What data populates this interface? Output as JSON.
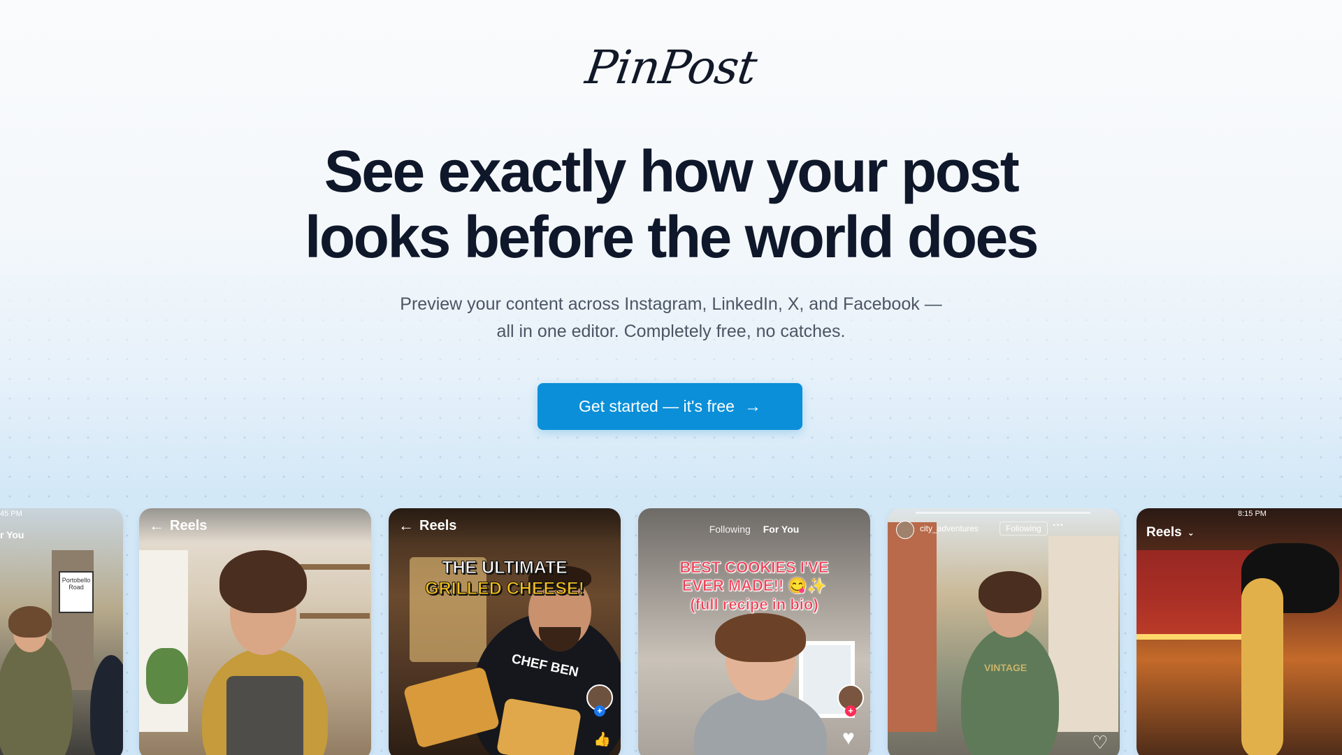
{
  "brand": {
    "logo_text": "PinPost"
  },
  "hero": {
    "headline_line1": "See exactly how your post",
    "headline_line2": "looks before the world does",
    "subhead_line1": "Preview your content across Instagram, LinkedIn, X, and Facebook —",
    "subhead_line2": "all in one editor. Completely free, no catches."
  },
  "cta": {
    "label": "Get started — it's free",
    "icon": "arrow-right-icon"
  },
  "colors": {
    "accent": "#0b8fd8",
    "heading": "#0f172a",
    "body": "#4b5563"
  },
  "previews": [
    {
      "status_time": "45 PM",
      "header": "r You",
      "sign_text": "Portobello Road",
      "platform": "tiktok"
    },
    {
      "header": "Reels",
      "platform": "instagram"
    },
    {
      "header": "Reels",
      "overlay_line1": "THE ULTIMATE",
      "overlay_line2": "GRILLED CHEESE!",
      "shirt_text": "CHEF BEN",
      "platform": "facebook"
    },
    {
      "tab_following": "Following",
      "tab_for_you": "For You",
      "overlay_line1": "BEST COOKIES I'VE",
      "overlay_line2": "EVER MADE!! 😋✨",
      "overlay_line3": "(full recipe in bio)",
      "platform": "tiktok"
    },
    {
      "username": "city_adventures",
      "follow_label": "Following",
      "more": "···",
      "shirt_text": "VINTAGE",
      "platform": "instagram"
    },
    {
      "status_time": "8:15 PM",
      "header": "Reels",
      "platform": "facebook"
    }
  ]
}
